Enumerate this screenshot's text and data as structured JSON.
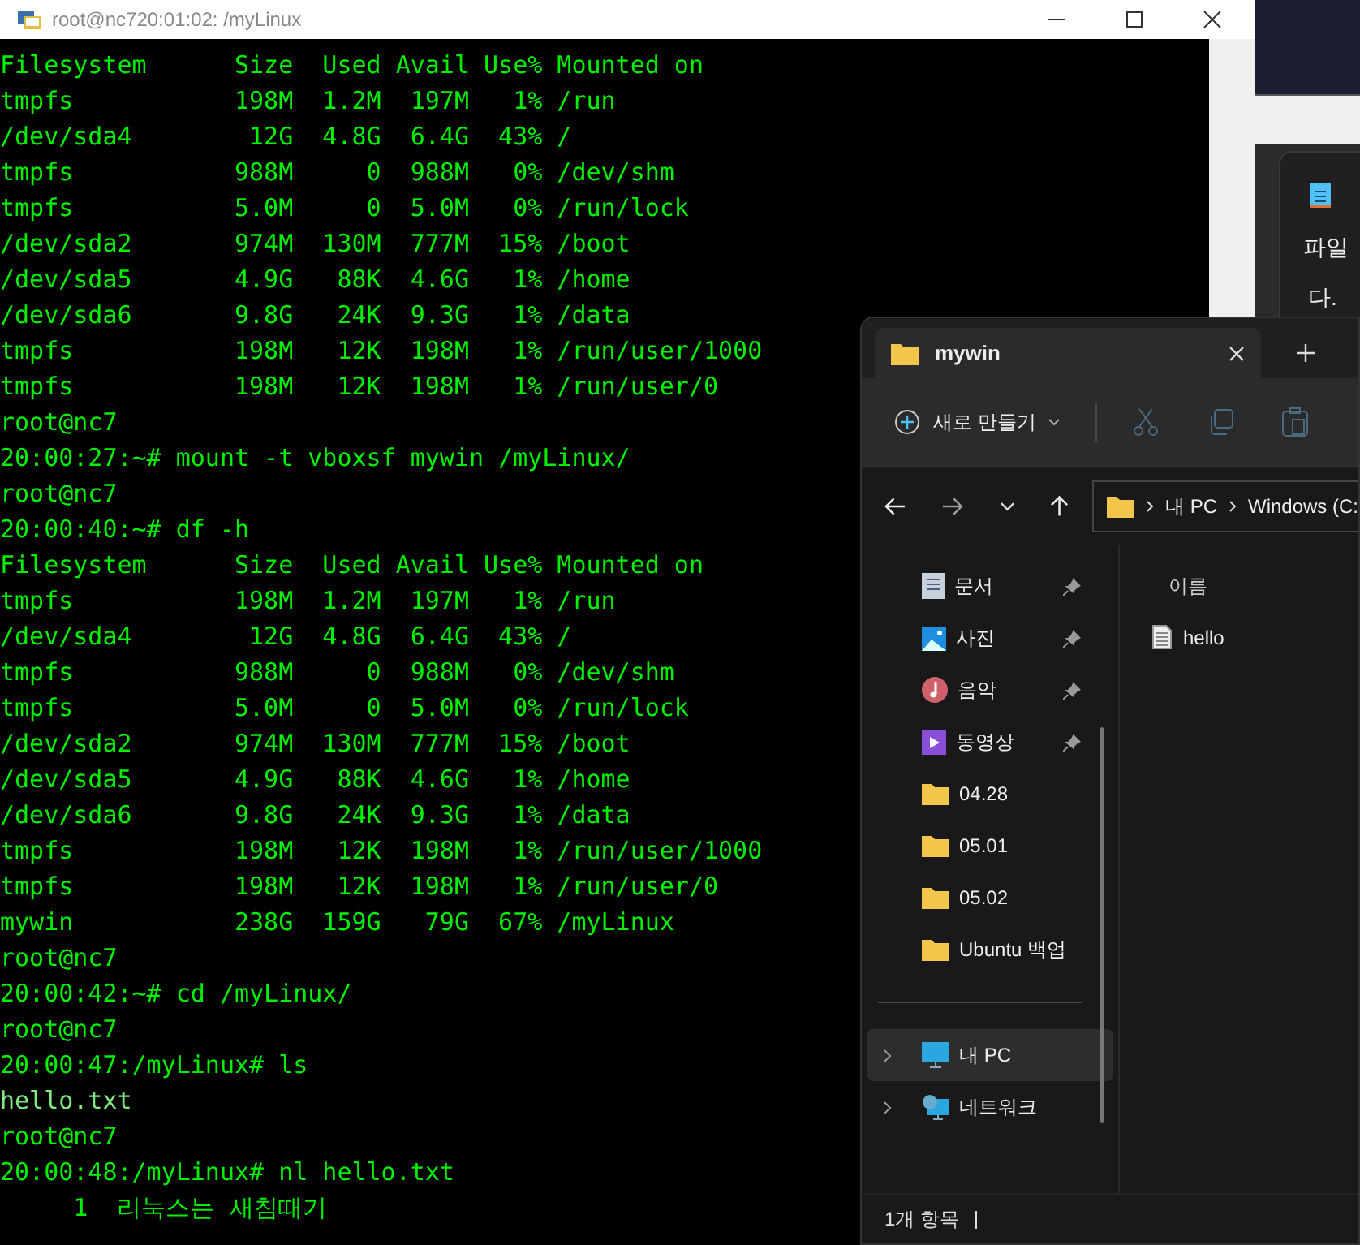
{
  "terminal": {
    "title": "root@nc720:01:02: /myLinux",
    "lines": [
      {
        "text": "Filesystem      Size  Used Avail Use% Mounted on",
        "kind": "output"
      },
      {
        "text": "tmpfs           198M  1.2M  197M   1% /run",
        "kind": "output"
      },
      {
        "text": "/dev/sda4        12G  4.8G  6.4G  43% /",
        "kind": "output"
      },
      {
        "text": "tmpfs           988M     0  988M   0% /dev/shm",
        "kind": "output"
      },
      {
        "text": "tmpfs           5.0M     0  5.0M   0% /run/lock",
        "kind": "output"
      },
      {
        "text": "/dev/sda2       974M  130M  777M  15% /boot",
        "kind": "output"
      },
      {
        "text": "/dev/sda5       4.9G   88K  4.6G   1% /home",
        "kind": "output"
      },
      {
        "text": "/dev/sda6       9.8G   24K  9.3G   1% /data",
        "kind": "output"
      },
      {
        "text": "tmpfs           198M   12K  198M   1% /run/user/1000",
        "kind": "output"
      },
      {
        "text": "tmpfs           198M   12K  198M   1% /run/user/0",
        "kind": "output"
      },
      {
        "text": "root@nc7",
        "kind": "output"
      },
      {
        "text": "20:00:27:~# mount -t vboxsf mywin /myLinux/",
        "kind": "output"
      },
      {
        "text": "root@nc7",
        "kind": "output"
      },
      {
        "text": "20:00:40:~# df -h",
        "kind": "output"
      },
      {
        "text": "Filesystem      Size  Used Avail Use% Mounted on",
        "kind": "output"
      },
      {
        "text": "tmpfs           198M  1.2M  197M   1% /run",
        "kind": "output"
      },
      {
        "text": "/dev/sda4        12G  4.8G  6.4G  43% /",
        "kind": "output"
      },
      {
        "text": "tmpfs           988M     0  988M   0% /dev/shm",
        "kind": "output"
      },
      {
        "text": "tmpfs           5.0M     0  5.0M   0% /run/lock",
        "kind": "output"
      },
      {
        "text": "/dev/sda2       974M  130M  777M  15% /boot",
        "kind": "output"
      },
      {
        "text": "/dev/sda5       4.9G   88K  4.6G   1% /home",
        "kind": "output"
      },
      {
        "text": "/dev/sda6       9.8G   24K  9.3G   1% /data",
        "kind": "output"
      },
      {
        "text": "tmpfs           198M   12K  198M   1% /run/user/1000",
        "kind": "output"
      },
      {
        "text": "tmpfs           198M   12K  198M   1% /run/user/0",
        "kind": "output"
      },
      {
        "text": "mywin           238G  159G   79G  67% /myLinux",
        "kind": "output"
      },
      {
        "text": "root@nc7",
        "kind": "output"
      },
      {
        "text": "20:00:42:~# cd /myLinux/",
        "kind": "output"
      },
      {
        "text": "root@nc7",
        "kind": "output"
      },
      {
        "text": "20:00:47:/myLinux# ls",
        "kind": "output"
      },
      {
        "text": "hello.txt",
        "kind": "file"
      },
      {
        "text": "root@nc7",
        "kind": "output"
      },
      {
        "text": "20:00:48:/myLinux# nl hello.txt",
        "kind": "output"
      },
      {
        "text": "     1  리눅스는 새침때기",
        "kind": "output"
      }
    ]
  },
  "notepad": {
    "menu_label": "파일",
    "text": "다."
  },
  "explorer": {
    "tab_title": "mywin",
    "new_label": "새로 만들기",
    "breadcrumb": [
      "내 PC",
      "Windows (C:"
    ],
    "sidebar": [
      {
        "label": "문서",
        "kind": "documents",
        "pinned": true,
        "selected": false,
        "expandable": false
      },
      {
        "label": "사진",
        "kind": "pictures",
        "pinned": true,
        "selected": false,
        "expandable": false
      },
      {
        "label": "음악",
        "kind": "music",
        "pinned": true,
        "selected": false,
        "expandable": false
      },
      {
        "label": "동영상",
        "kind": "videos",
        "pinned": true,
        "selected": false,
        "expandable": false
      },
      {
        "label": "04.28",
        "kind": "folder",
        "pinned": false,
        "selected": false,
        "expandable": false
      },
      {
        "label": "05.01",
        "kind": "folder",
        "pinned": false,
        "selected": false,
        "expandable": false
      },
      {
        "label": "05.02",
        "kind": "folder",
        "pinned": false,
        "selected": false,
        "expandable": false
      },
      {
        "label": "Ubuntu 백업",
        "kind": "folder",
        "pinned": false,
        "selected": false,
        "expandable": false
      },
      {
        "kind": "divider"
      },
      {
        "label": "내 PC",
        "kind": "pc",
        "pinned": false,
        "selected": true,
        "expandable": true
      },
      {
        "label": "네트워크",
        "kind": "network",
        "pinned": false,
        "selected": false,
        "expandable": true
      }
    ],
    "column_header": "이름",
    "files": [
      {
        "name": "hello"
      }
    ],
    "status": "1개 항목"
  }
}
